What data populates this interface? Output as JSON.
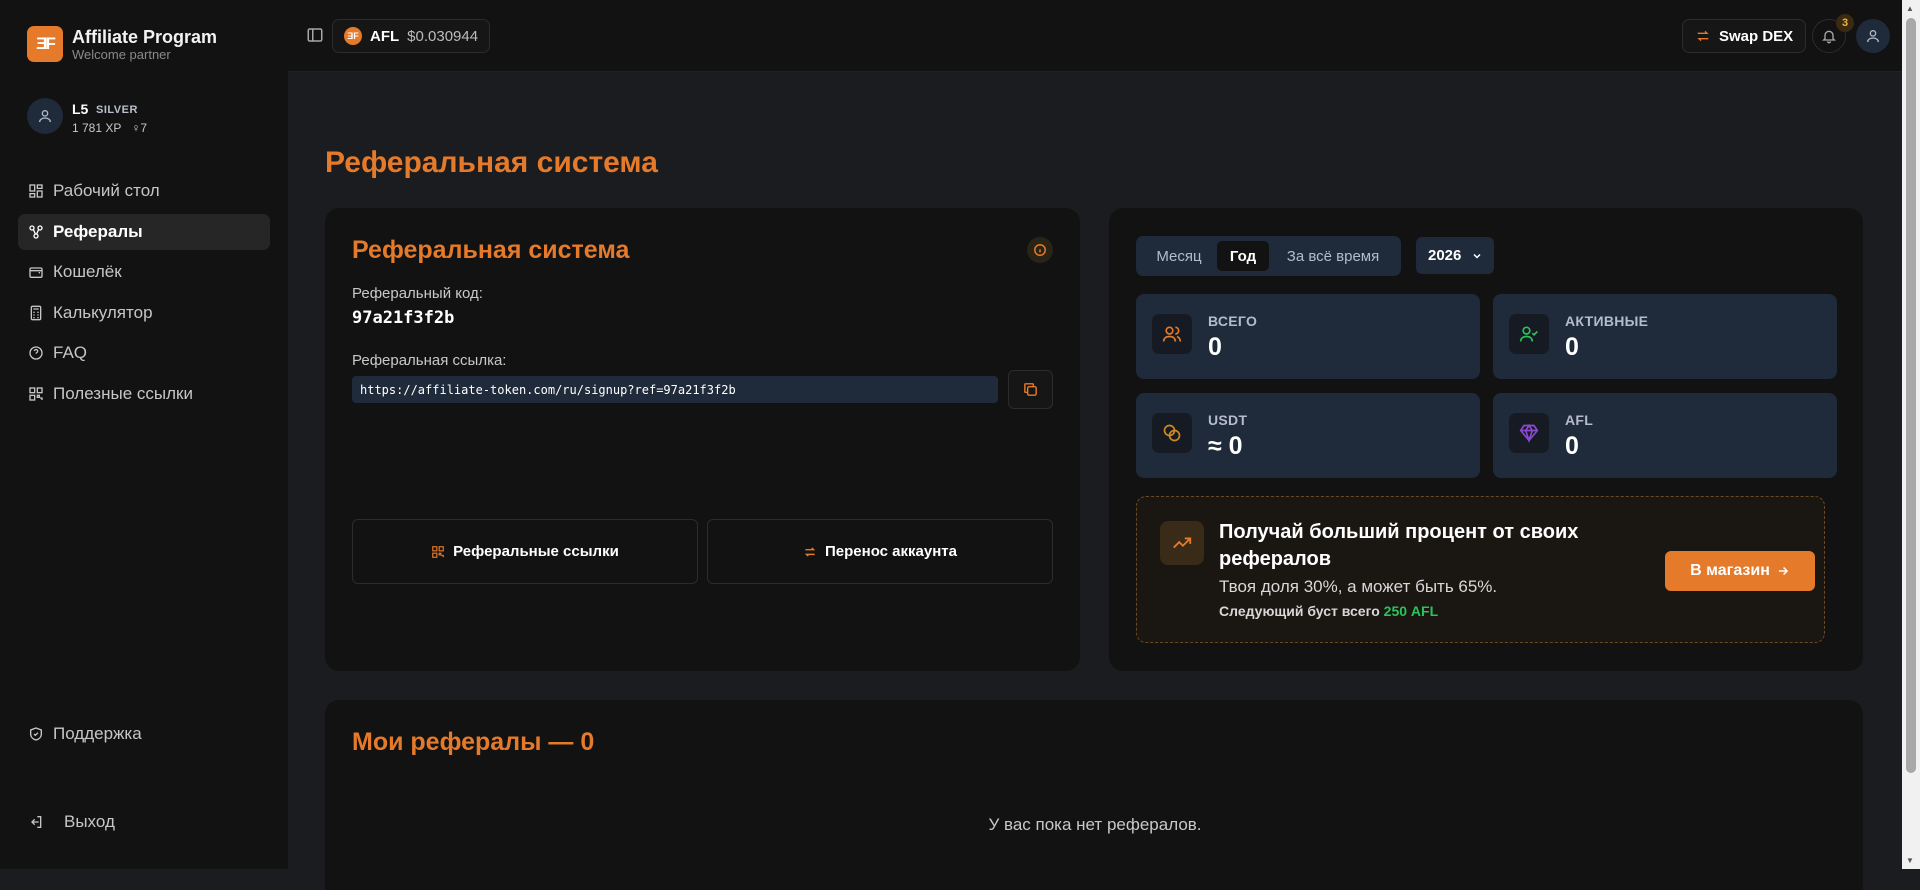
{
  "app": {
    "title": "Affiliate Program",
    "subtitle": "Welcome partner",
    "logo_text": "ƎF"
  },
  "user": {
    "level": "L5",
    "tier": "SILVER",
    "xp": "1 781 XP",
    "refs": "♀7"
  },
  "sidebar": {
    "items": [
      {
        "label": "Рабочий стол",
        "icon": "dashboard-icon"
      },
      {
        "label": "Рефералы",
        "icon": "referrals-icon",
        "active": true
      },
      {
        "label": "Кошелёк",
        "icon": "wallet-icon"
      },
      {
        "label": "Калькулятор",
        "icon": "calculator-icon"
      },
      {
        "label": "FAQ",
        "icon": "help-icon"
      },
      {
        "label": "Полезные ссылки",
        "icon": "links-icon"
      }
    ],
    "support": "Поддержка",
    "logout": "Выход"
  },
  "topbar": {
    "token_symbol": "AFL",
    "token_price": "$0.030944",
    "swap_label": "Swap DEX",
    "notifications_count": "3"
  },
  "page": {
    "title": "Реферальная система"
  },
  "referral_card": {
    "title": "Реферальная система",
    "code_label": "Реферальный код:",
    "code": "97a21f3f2b",
    "link_label": "Реферальная ссылка:",
    "link": "https://affiliate-token.com/ru/signup?ref=97a21f3f2b",
    "btn_links": "Реферальные ссылки",
    "btn_transfer": "Перенос аккаунта"
  },
  "stats_card": {
    "tabs": [
      "Месяц",
      "Год",
      "За всё время"
    ],
    "active_tab": "Год",
    "year": "2026",
    "stats": [
      {
        "label": "ВСЕГО",
        "value": "0",
        "icon": "users-icon",
        "color": "#e47a2a"
      },
      {
        "label": "АКТИВНЫЕ",
        "value": "0",
        "icon": "user-check-icon",
        "color": "#2bc25c"
      },
      {
        "label": "USDT",
        "value": "≈ 0",
        "icon": "coins-icon",
        "color": "#d08a20"
      },
      {
        "label": "AFL",
        "value": "0",
        "icon": "diamond-icon",
        "color": "#8a4ad0"
      }
    ],
    "promo": {
      "title": "Получай больший процент от своих рефералов",
      "subtitle": "Твоя доля 30%, а может быть 65%.",
      "next_prefix": "Следующий буст всего",
      "next_value": "250 AFL",
      "button": "В магазин"
    }
  },
  "my_referrals": {
    "title": "Мои рефералы — 0",
    "empty": "У вас пока нет рефералов."
  },
  "colors": {
    "accent": "#e47a2a",
    "bg": "#1a1c1f",
    "card": "#121212",
    "tile": "#1f2a3a",
    "success": "#2bc25c"
  }
}
